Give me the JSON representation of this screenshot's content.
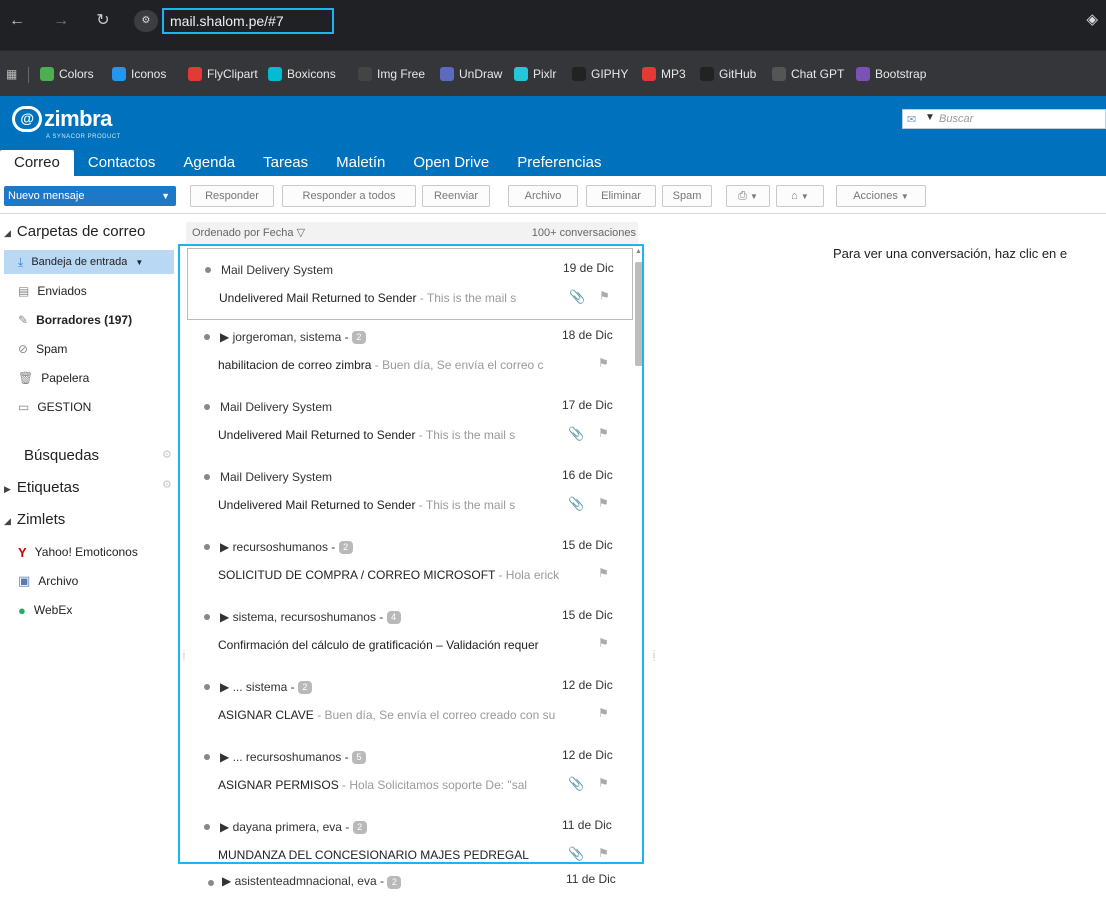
{
  "browser": {
    "url": "mail.shalom.pe/#7",
    "bookmarks": [
      {
        "label": "Colors",
        "color": "#4caf50"
      },
      {
        "label": "Iconos",
        "color": "#2196f3"
      },
      {
        "label": "FlyClipart",
        "color": "#e53935"
      },
      {
        "label": "Boxicons",
        "color": "#00bcd4"
      },
      {
        "label": "Img Free",
        "color": "#444444"
      },
      {
        "label": "UnDraw",
        "color": "#5c6bc0"
      },
      {
        "label": "Pixlr",
        "color": "#26c6da"
      },
      {
        "label": "GIPHY",
        "color": "#222222"
      },
      {
        "label": "MP3",
        "color": "#e53935"
      },
      {
        "label": "GitHub",
        "color": "#222222"
      },
      {
        "label": "Chat GPT",
        "color": "#555555"
      },
      {
        "label": "Bootstrap",
        "color": "#7952b3"
      }
    ]
  },
  "header": {
    "logo": "zimbra",
    "logo_sub": "A SYNACOR PRODUCT",
    "search_placeholder": "Buscar",
    "tabs": [
      "Correo",
      "Contactos",
      "Agenda",
      "Tareas",
      "Maletín",
      "Open Drive",
      "Preferencias"
    ]
  },
  "toolbar": {
    "new_message": "Nuevo mensaje",
    "reply": "Responder",
    "reply_all": "Responder a todos",
    "forward": "Reenviar",
    "archive": "Archivo",
    "delete": "Eliminar",
    "spam": "Spam",
    "actions": "Acciones"
  },
  "sidebar": {
    "mail_folders": "Carpetas de correo",
    "folders": [
      {
        "label": "Bandeja de entrada"
      },
      {
        "label": "Enviados"
      },
      {
        "label": "Borradores (197)"
      },
      {
        "label": "Spam"
      },
      {
        "label": "Papelera"
      },
      {
        "label": "GESTION"
      }
    ],
    "searches": "Búsquedas",
    "tags": "Etiquetas",
    "zimlets": "Zimlets",
    "zimlet_items": [
      {
        "label": "Yahoo! Emoticonos"
      },
      {
        "label": "Archivo"
      },
      {
        "label": "WebEx"
      }
    ]
  },
  "list": {
    "sort_label": "Ordenado por Fecha",
    "count_label": "100+ conversaciones",
    "messages": [
      {
        "from": "Mail Delivery System",
        "count": "",
        "date": "19 de Dic",
        "subject": "Undelivered Mail Returned to Sender",
        "fragment": " - This is the mail s",
        "attachment": true
      },
      {
        "from": "jorgeroman, sistema - ",
        "count": "2",
        "date": "18 de Dic",
        "subject": "habilitacion de correo zimbra",
        "fragment": " - Buen día, Se envía el correo c",
        "attachment": false
      },
      {
        "from": "Mail Delivery System",
        "count": "",
        "date": "17 de Dic",
        "subject": "Undelivered Mail Returned to Sender",
        "fragment": " - This is the mail s",
        "attachment": true
      },
      {
        "from": "Mail Delivery System",
        "count": "",
        "date": "16 de Dic",
        "subject": "Undelivered Mail Returned to Sender",
        "fragment": " - This is the mail s",
        "attachment": true
      },
      {
        "from": "recursoshumanos - ",
        "count": "2",
        "date": "15 de Dic",
        "subject": "SOLICITUD DE COMPRA / CORREO MICROSOFT",
        "fragment": " - Hola erick",
        "attachment": false
      },
      {
        "from": "sistema, recursoshumanos - ",
        "count": "4",
        "date": "15 de Dic",
        "subject": "Confirmación del cálculo de gratificación – Validación requer",
        "fragment": "",
        "attachment": false
      },
      {
        "from": "... sistema - ",
        "count": "2",
        "date": "12 de Dic",
        "subject": "ASIGNAR CLAVE",
        "fragment": " - Buen día, Se envía el correo creado con su",
        "attachment": false
      },
      {
        "from": "... recursoshumanos - ",
        "count": "5",
        "date": "12 de Dic",
        "subject": "ASIGNAR PERMISOS",
        "fragment": " - Hola Solicitamos soporte De: \"sal",
        "attachment": true
      },
      {
        "from": "dayana primera, eva - ",
        "count": "2",
        "date": "11 de Dic",
        "subject": "MUNDANZA DEL CONCESIONARIO  MAJES PEDREGAL",
        "fragment": "",
        "attachment": true
      }
    ],
    "partial": {
      "from": "asistenteadmnacional, eva - ",
      "count": "2",
      "date": "11 de Dic"
    }
  },
  "reading_pane": {
    "hint": "Para ver una conversación, haz clic en e"
  }
}
